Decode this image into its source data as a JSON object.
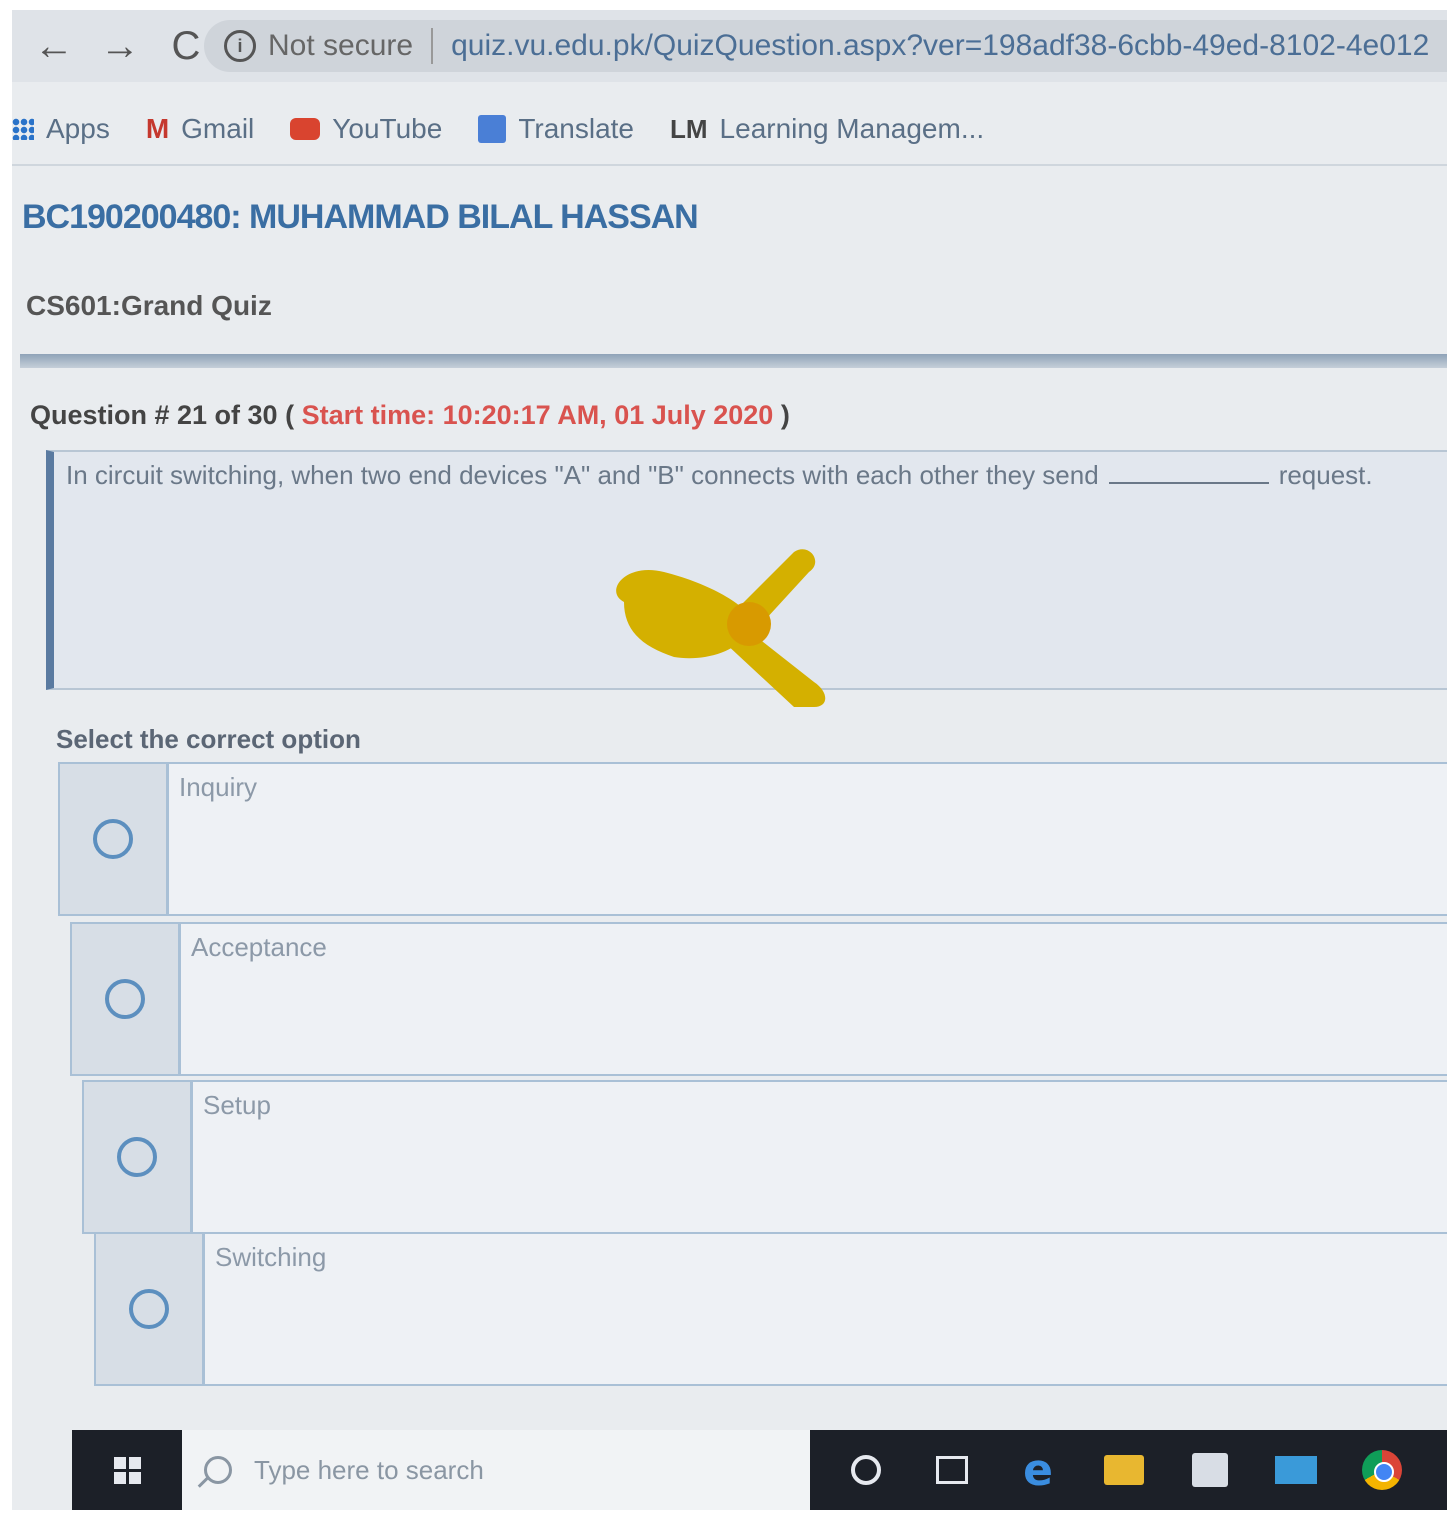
{
  "browser": {
    "nav": {
      "back": "←",
      "forward": "→",
      "reload": "C"
    },
    "security": "Not secure",
    "url": "quiz.vu.edu.pk/QuizQuestion.aspx?ver=198adf38-6cbb-49ed-8102-4e012",
    "bookmarks": [
      "Apps",
      "Gmail",
      "YouTube",
      "Translate",
      "Learning Managem..."
    ]
  },
  "page": {
    "student": "BC190200480: MUHAMMAD BILAL HASSAN",
    "quiz_title": "CS601:Grand Quiz",
    "question_header": "Question # 21 of 30 (",
    "start_time": "Start time: 10:20:17 AM, 01 July 2020",
    "question_header_close": ")",
    "question_text_before": "In circuit switching, when two end devices \"A\" and \"B\" connects with each other they send",
    "question_text_after": "request.",
    "select_label": "Select the correct option",
    "options": [
      "Inquiry",
      "Acceptance",
      "Setup",
      "Switching"
    ]
  },
  "taskbar": {
    "search_placeholder": "Type here to search"
  },
  "colors": {
    "accent": "#3a6ea3",
    "start_time": "#d9534f",
    "highlight_mark": "#d4b000"
  }
}
